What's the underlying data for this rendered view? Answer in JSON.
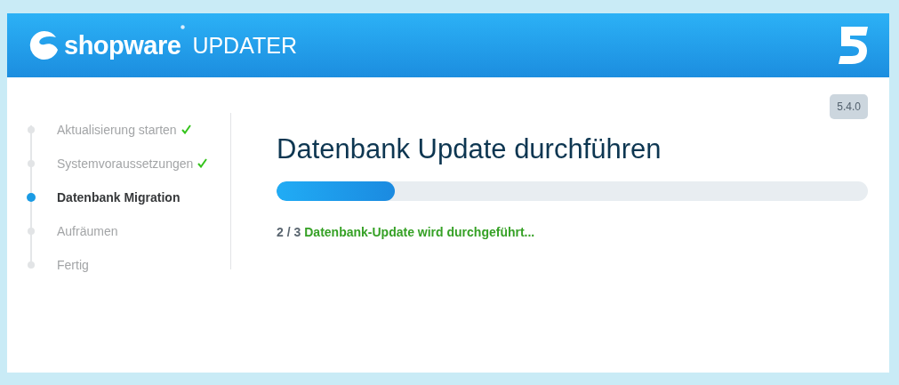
{
  "header": {
    "brand": "shopware",
    "product": "UPDATER"
  },
  "version": "5.4.0",
  "steps": [
    {
      "label": "Aktualisierung starten",
      "done": true,
      "selected": false
    },
    {
      "label": "Systemvoraussetzungen",
      "done": true,
      "selected": false
    },
    {
      "label": "Datenbank Migration",
      "done": false,
      "selected": true
    },
    {
      "label": "Aufräumen",
      "done": false,
      "selected": false
    },
    {
      "label": "Fertig",
      "done": false,
      "selected": false
    }
  ],
  "title": "Datenbank Update durchführen",
  "progress": {
    "level": 0.2
  },
  "status": {
    "counter": "2 / 3",
    "message": "Datenbank-Update wird durchgeführt..."
  }
}
